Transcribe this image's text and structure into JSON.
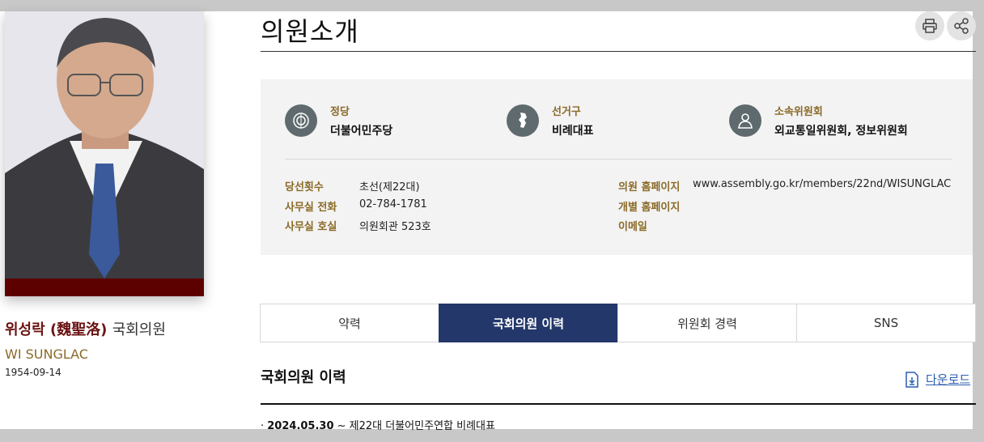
{
  "page_title": "의원소개",
  "member": {
    "name_kr": "위성락 (魏聖洛)",
    "name_suffix": "국회의원",
    "name_en": "WI SUNGLAC",
    "birth": "1954-09-14"
  },
  "toolbar": {
    "print_icon": "printer-icon",
    "share_icon": "share-icon"
  },
  "info_top": [
    {
      "label": "정당",
      "value": "더불어민주당",
      "icon": "party-emblem-icon"
    },
    {
      "label": "선거구",
      "value": "비례대표",
      "icon": "korea-map-icon"
    },
    {
      "label": "소속위원회",
      "value": "외교통일위원회, 정보위원회",
      "icon": "person-icon"
    }
  ],
  "details_left": [
    {
      "label": "당선횟수",
      "value": "초선(제22대)"
    },
    {
      "label": "사무실 전화",
      "value": "02-784-1781"
    },
    {
      "label": "사무실 호실",
      "value": "의원회관 523호"
    }
  ],
  "details_right": [
    {
      "label": "의원 홈페이지",
      "value": "www.assembly.go.kr/members/22nd/WISUNGLAC"
    },
    {
      "label": "개별 홈페이지",
      "value": ""
    },
    {
      "label": "이메일",
      "value": ""
    }
  ],
  "tabs": [
    {
      "label": "약력",
      "active": false
    },
    {
      "label": "국회의원 이력",
      "active": true
    },
    {
      "label": "위원회 경력",
      "active": false
    },
    {
      "label": "SNS",
      "active": false
    }
  ],
  "section": {
    "title": "국회의원 이력",
    "download_label": "다운로드"
  },
  "history": [
    {
      "date": "2024.05.30",
      "text": " ~ 제22대 더불어민주연합 비례대표"
    }
  ],
  "colors": {
    "accent_navy": "#23376a",
    "label_gold": "#8a6a27",
    "name_maroon": "#6b1313",
    "photo_bar": "#5c0000"
  }
}
